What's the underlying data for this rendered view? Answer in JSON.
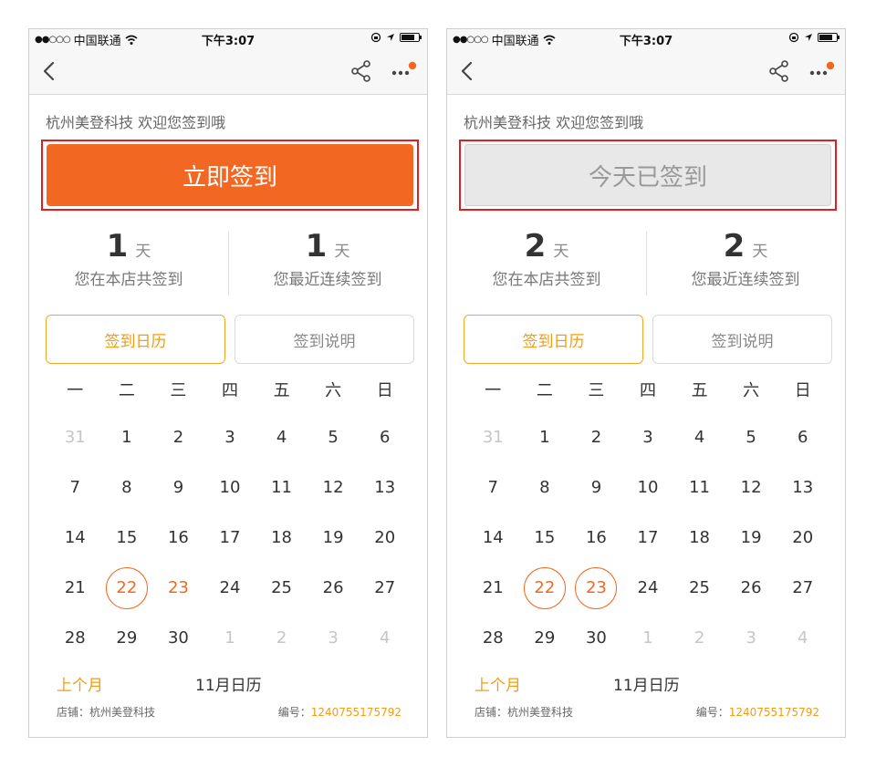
{
  "colors": {
    "accent": "#f26822",
    "highlight_border": "#e02020",
    "tab_accent": "#f39c12",
    "done_button_bg": "#e8e8e8"
  },
  "screens": [
    {
      "status": {
        "dots": "●●○○○",
        "carrier": "中国联通",
        "time": "下午3:07"
      },
      "welcome": "杭州美登科技 欢迎您签到哦",
      "signin_button": "立即签到",
      "stats": {
        "total_num": "1",
        "total_unit": "天",
        "total_label": "您在本店共签到",
        "streak_num": "1",
        "streak_unit": "天",
        "streak_label": "您最近连续签到"
      },
      "tabs": {
        "calendar": "签到日历",
        "help": "签到说明"
      },
      "weekdays": [
        "一",
        "二",
        "三",
        "四",
        "五",
        "六",
        "日"
      ],
      "days": [
        [
          {
            "d": "31",
            "muted": true
          },
          {
            "d": "1"
          },
          {
            "d": "2"
          },
          {
            "d": "3"
          },
          {
            "d": "4"
          },
          {
            "d": "5"
          },
          {
            "d": "6"
          }
        ],
        [
          {
            "d": "7"
          },
          {
            "d": "8"
          },
          {
            "d": "9"
          },
          {
            "d": "10"
          },
          {
            "d": "11"
          },
          {
            "d": "12"
          },
          {
            "d": "13"
          }
        ],
        [
          {
            "d": "14"
          },
          {
            "d": "15"
          },
          {
            "d": "16"
          },
          {
            "d": "17"
          },
          {
            "d": "18"
          },
          {
            "d": "19"
          },
          {
            "d": "20"
          }
        ],
        [
          {
            "d": "21"
          },
          {
            "d": "22",
            "signed": true
          },
          {
            "d": "23",
            "today": true
          },
          {
            "d": "24"
          },
          {
            "d": "25"
          },
          {
            "d": "26"
          },
          {
            "d": "27"
          }
        ],
        [
          {
            "d": "28"
          },
          {
            "d": "29"
          },
          {
            "d": "30"
          },
          {
            "d": "1",
            "muted": true
          },
          {
            "d": "2",
            "muted": true
          },
          {
            "d": "3",
            "muted": true
          },
          {
            "d": "4",
            "muted": true
          }
        ]
      ],
      "prev_month": "上个月",
      "month_title": "11月日历",
      "shop_label": "店铺：",
      "shop_name": "杭州美登科技",
      "code_label": "编号：",
      "code_value": "1240755175792"
    },
    {
      "status": {
        "dots": "●●○○○",
        "carrier": "中国联通",
        "time": "下午3:07"
      },
      "welcome": "杭州美登科技 欢迎您签到哦",
      "signin_button": "今天已签到",
      "stats": {
        "total_num": "2",
        "total_unit": "天",
        "total_label": "您在本店共签到",
        "streak_num": "2",
        "streak_unit": "天",
        "streak_label": "您最近连续签到"
      },
      "tabs": {
        "calendar": "签到日历",
        "help": "签到说明"
      },
      "weekdays": [
        "一",
        "二",
        "三",
        "四",
        "五",
        "六",
        "日"
      ],
      "days": [
        [
          {
            "d": "31",
            "muted": true
          },
          {
            "d": "1"
          },
          {
            "d": "2"
          },
          {
            "d": "3"
          },
          {
            "d": "4"
          },
          {
            "d": "5"
          },
          {
            "d": "6"
          }
        ],
        [
          {
            "d": "7"
          },
          {
            "d": "8"
          },
          {
            "d": "9"
          },
          {
            "d": "10"
          },
          {
            "d": "11"
          },
          {
            "d": "12"
          },
          {
            "d": "13"
          }
        ],
        [
          {
            "d": "14"
          },
          {
            "d": "15"
          },
          {
            "d": "16"
          },
          {
            "d": "17"
          },
          {
            "d": "18"
          },
          {
            "d": "19"
          },
          {
            "d": "20"
          }
        ],
        [
          {
            "d": "21"
          },
          {
            "d": "22",
            "signed": true
          },
          {
            "d": "23",
            "signed": true
          },
          {
            "d": "24"
          },
          {
            "d": "25"
          },
          {
            "d": "26"
          },
          {
            "d": "27"
          }
        ],
        [
          {
            "d": "28"
          },
          {
            "d": "29"
          },
          {
            "d": "30"
          },
          {
            "d": "1",
            "muted": true
          },
          {
            "d": "2",
            "muted": true
          },
          {
            "d": "3",
            "muted": true
          },
          {
            "d": "4",
            "muted": true
          }
        ]
      ],
      "prev_month": "上个月",
      "month_title": "11月日历",
      "shop_label": "店铺：",
      "shop_name": "杭州美登科技",
      "code_label": "编号：",
      "code_value": "1240755175792"
    }
  ]
}
